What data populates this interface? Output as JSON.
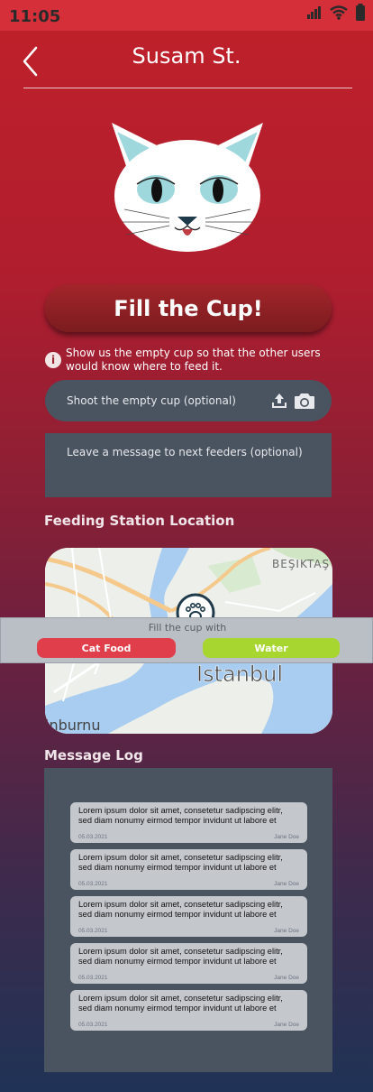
{
  "status": {
    "time": "11:05"
  },
  "header": {
    "title": "Susam St."
  },
  "fill_button": "Fill the Cup!",
  "info": {
    "text": "Show us the empty cup so that the other users would know where to feed it."
  },
  "shoot": {
    "placeholder": "Shoot the empty cup (optional)"
  },
  "message": {
    "placeholder": "Leave a message to next feeders (optional)"
  },
  "location": {
    "title": "Feeding Station Location",
    "map_labels": {
      "district_top": "BEŞIKTAŞ",
      "city": "Istanbul",
      "district_bottom": "inburnu"
    }
  },
  "fill_with": {
    "label": "Fill the cup with",
    "cat_food": "Cat Food",
    "water": "Water"
  },
  "log": {
    "title": "Message Log",
    "entries": [
      {
        "text": "Lorem ipsum dolor sit amet, consetetur sadipscing elitr, sed diam nonumy eirmod tempor invidunt ut labore et",
        "date": "05.03.2021",
        "author": "Jane Doe"
      },
      {
        "text": "Lorem ipsum dolor sit amet, consetetur sadipscing elitr, sed diam nonumy eirmod tempor invidunt ut labore et",
        "date": "05.03.2021",
        "author": "Jane Doe"
      },
      {
        "text": "Lorem ipsum dolor sit amet, consetetur sadipscing elitr, sed diam nonumy eirmod tempor invidunt ut labore et",
        "date": "05.03.2021",
        "author": "Jane Doe"
      },
      {
        "text": "Lorem ipsum dolor sit amet, consetetur sadipscing elitr, sed diam nonumy eirmod tempor invidunt ut labore et",
        "date": "05.03.2021",
        "author": "Jane Doe"
      },
      {
        "text": "Lorem ipsum dolor sit amet, consetetur sadipscing elitr, sed diam nonumy eirmod tempor invidunt ut labore et",
        "date": "05.03.2021",
        "author": "Jane Doe"
      }
    ]
  },
  "colors": {
    "status_bar": "#d5303a",
    "fill_button": "#8f2025",
    "cat_food": "#e13e4c",
    "water": "#a6d62f",
    "panel": "#4a5360"
  },
  "icons": [
    "signal-icon",
    "wifi-icon",
    "battery-icon",
    "back-chevron-icon",
    "info-icon",
    "upload-icon",
    "camera-icon",
    "paw-icon"
  ]
}
